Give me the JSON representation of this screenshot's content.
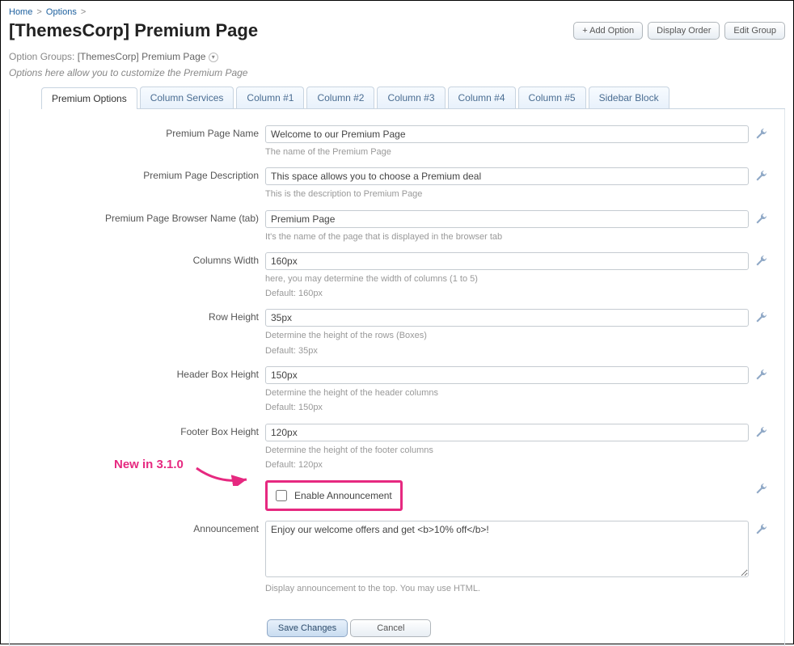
{
  "breadcrumb": {
    "home": "Home",
    "options": "Options",
    "sep": ">"
  },
  "page_title": "[ThemesCorp] Premium Page",
  "top_buttons": {
    "add_option": "+ Add Option",
    "display_order": "Display Order",
    "edit_group": "Edit Group"
  },
  "option_groups": {
    "label": "Option Groups:",
    "value": "[ThemesCorp] Premium Page"
  },
  "tagline": "Options here allow you to customize the Premium Page",
  "tabs": [
    {
      "label": "Premium Options",
      "active": true
    },
    {
      "label": "Column Services"
    },
    {
      "label": "Column #1"
    },
    {
      "label": "Column #2"
    },
    {
      "label": "Column #3"
    },
    {
      "label": "Column #4"
    },
    {
      "label": "Column #5"
    },
    {
      "label": "Sidebar Block"
    }
  ],
  "fields": {
    "name": {
      "label": "Premium Page Name",
      "value": "Welcome to our Premium Page",
      "help": "The name of the Premium Page"
    },
    "description": {
      "label": "Premium Page Description",
      "value": "This space allows you to choose a Premium deal",
      "help": "This is the description to Premium Page"
    },
    "browser_name": {
      "label": "Premium Page Browser Name (tab)",
      "value": "Premium Page",
      "help": "It's the name of the page that is displayed in the browser tab"
    },
    "columns_width": {
      "label": "Columns Width",
      "value": "160px",
      "help1": "here, you may determine the width of columns (1 to 5)",
      "help2": "Default: 160px"
    },
    "row_height": {
      "label": "Row Height",
      "value": "35px",
      "help1": "Determine the height of the rows (Boxes)",
      "help2": "Default: 35px"
    },
    "header_box_height": {
      "label": "Header Box Height",
      "value": "150px",
      "help1": "Determine the height of the header columns",
      "help2": "Default: 150px"
    },
    "footer_box_height": {
      "label": "Footer Box Height",
      "value": "120px",
      "help1": "Determine the height of the footer columns",
      "help2": "Default: 120px"
    },
    "enable_announcement": {
      "label": "Enable Announcement",
      "checked": false
    },
    "announcement": {
      "label": "Announcement",
      "value": "Enjoy our welcome offers and get <b>10% off</b>!",
      "help": "Display announcement to the top. You may use HTML."
    }
  },
  "annotation": "New in 3.1.0",
  "actions": {
    "save": "Save Changes",
    "cancel": "Cancel"
  },
  "colors": {
    "accent": "#e62980",
    "link": "#1b5f9e"
  }
}
